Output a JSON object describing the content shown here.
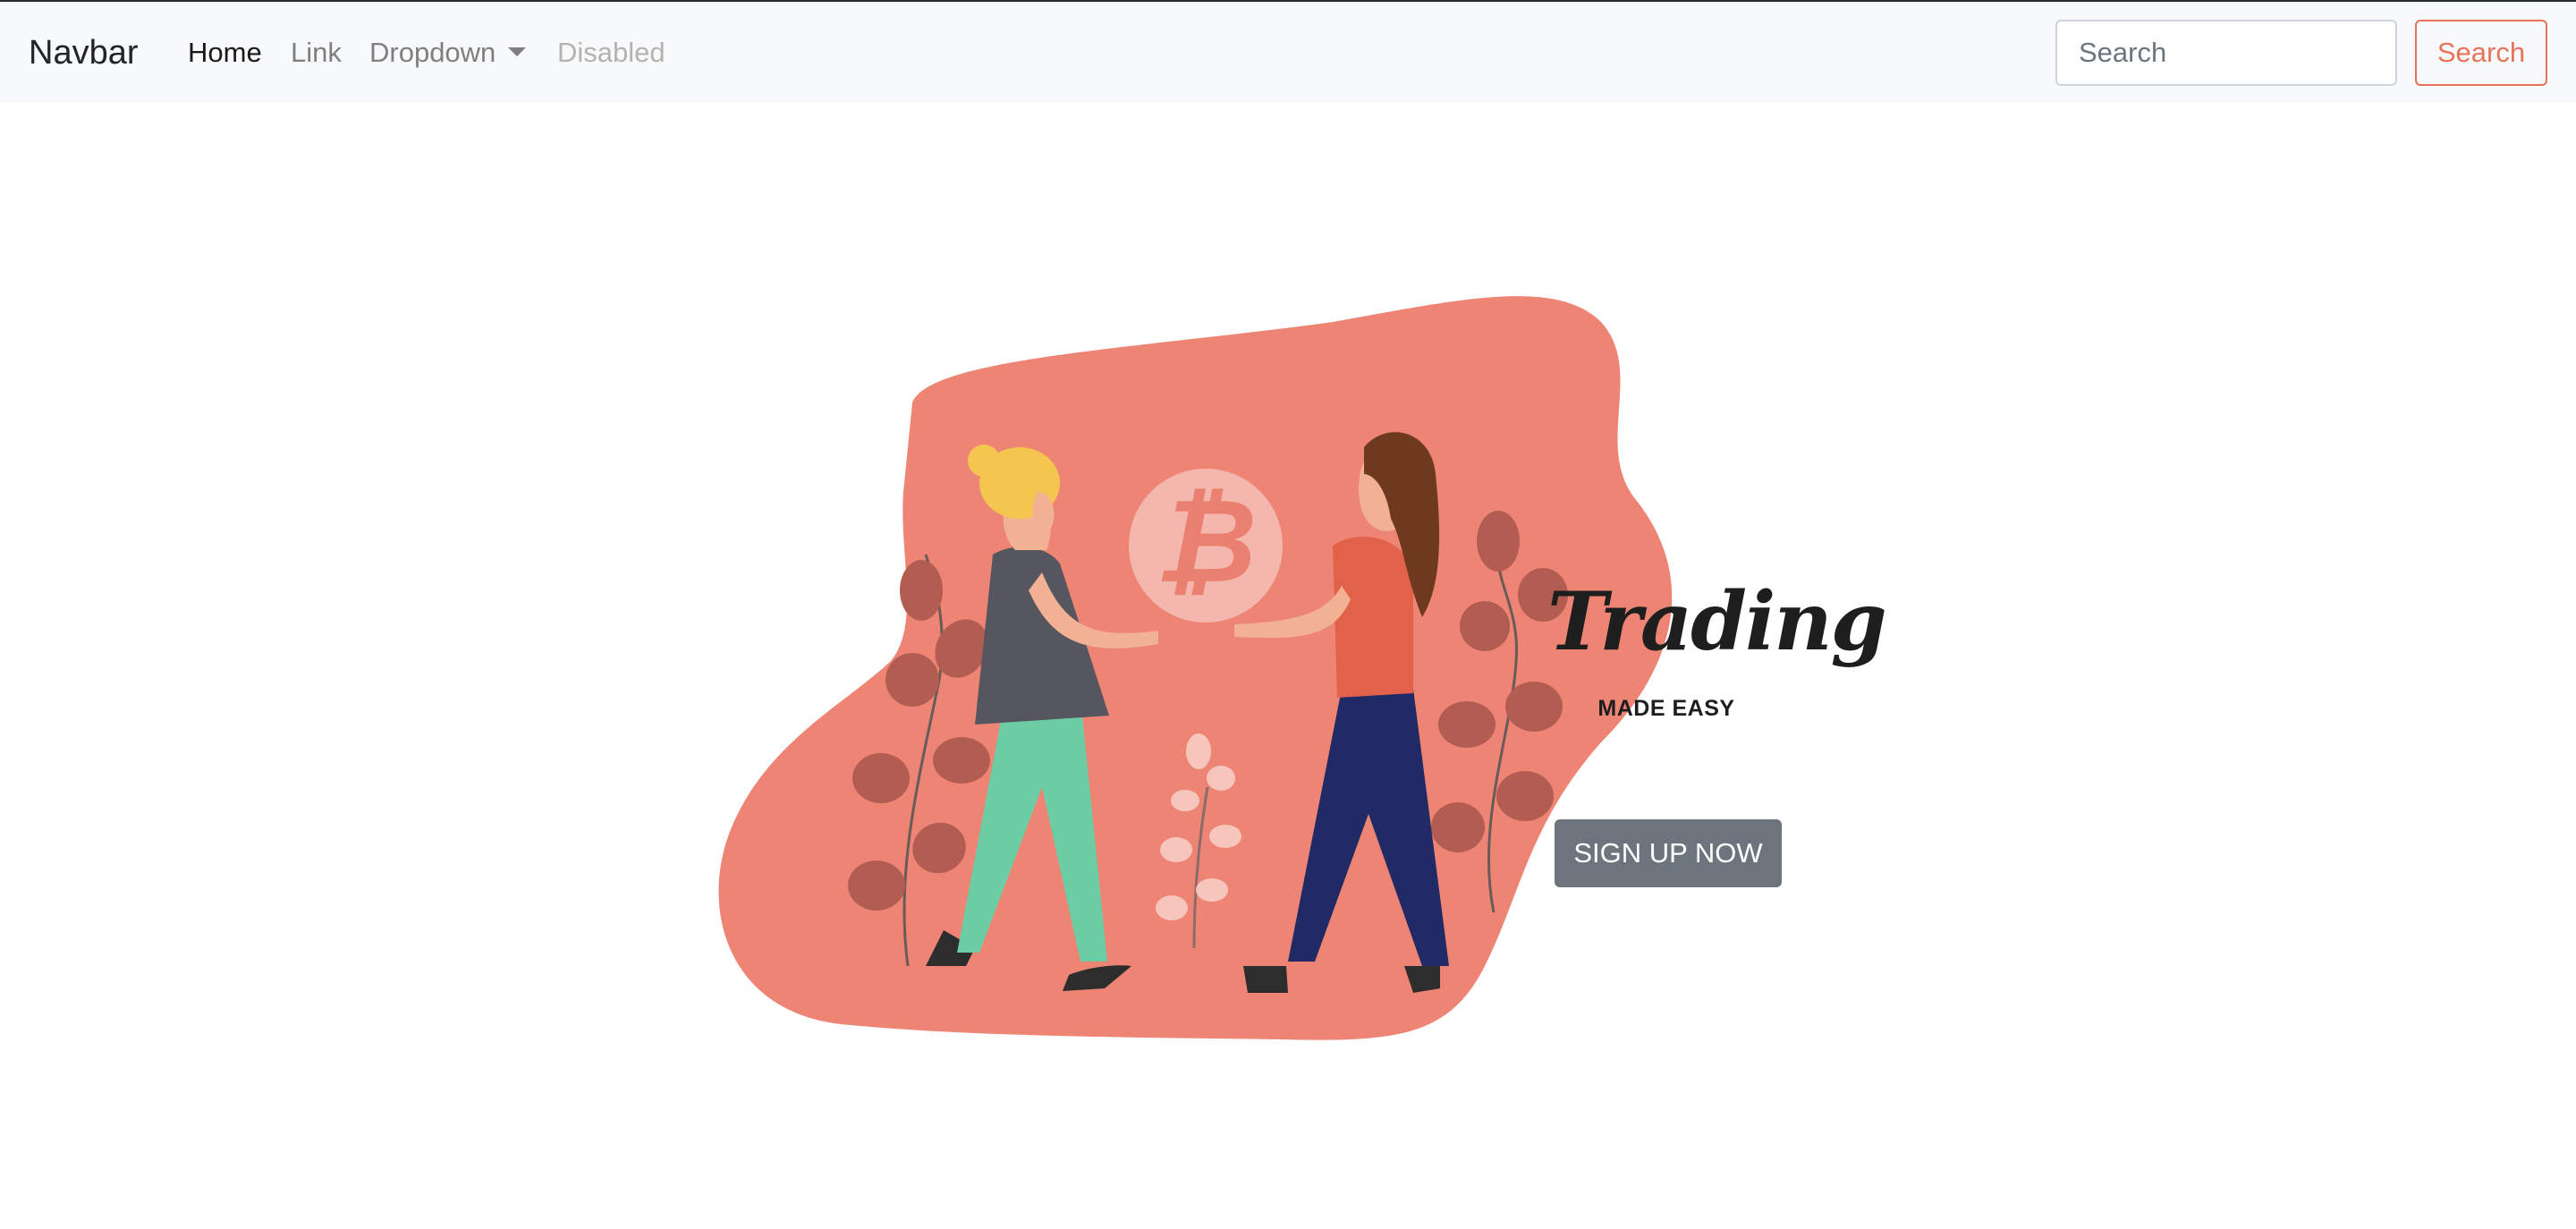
{
  "navbar": {
    "brand": "Navbar",
    "links": [
      {
        "label": "Home",
        "state": "active"
      },
      {
        "label": "Link",
        "state": "normal"
      },
      {
        "label": "Dropdown",
        "state": "normal"
      },
      {
        "label": "Disabled",
        "state": "disabled"
      }
    ],
    "search": {
      "placeholder": "Search",
      "value": "",
      "button_label": "Search"
    }
  },
  "hero": {
    "title": "Trading",
    "subtitle": "MADE EASY",
    "cta_label": "SIGN UP NOW",
    "coin_symbol": "₿"
  },
  "colors": {
    "accent": "#e8735a",
    "blob": "#ee8574",
    "cta_bg": "#6c757d",
    "navbar_bg": "#f8f9fa"
  },
  "icons": [
    "caret-down-icon",
    "bitcoin-coin-icon"
  ]
}
